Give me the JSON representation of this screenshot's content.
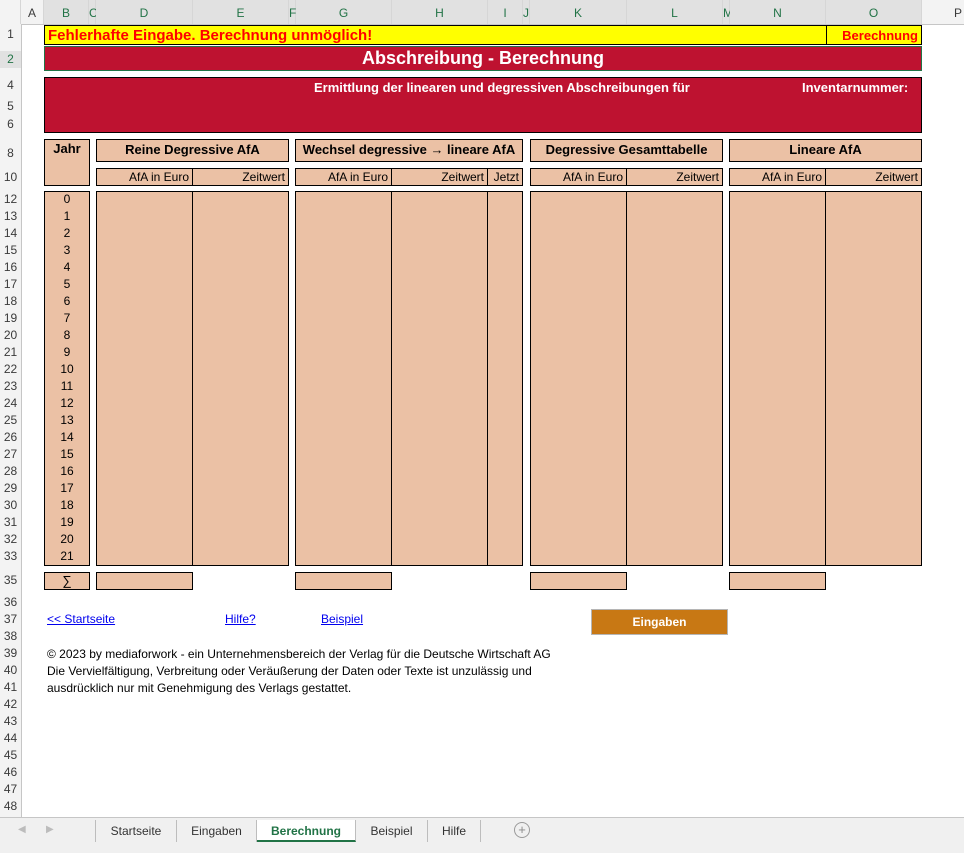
{
  "columns": [
    "A",
    "B",
    "C",
    "D",
    "E",
    "F",
    "G",
    "H",
    "I",
    "J",
    "K",
    "L",
    "M",
    "N",
    "O",
    "P"
  ],
  "rows": [
    "1",
    "2",
    "4",
    "5",
    "6",
    "8",
    "10",
    "12",
    "13",
    "14",
    "15",
    "16",
    "17",
    "18",
    "19",
    "20",
    "21",
    "22",
    "23",
    "24",
    "25",
    "26",
    "27",
    "28",
    "29",
    "30",
    "31",
    "32",
    "33",
    "35",
    "36",
    "37",
    "38",
    "39",
    "40",
    "41",
    "42",
    "43",
    "44",
    "45",
    "46",
    "47",
    "48"
  ],
  "error_banner": "Fehlerhafte Eingabe. Berechnung unmöglich!",
  "error_right": "Berechnung",
  "title": "Abschreibung - Berechnung",
  "subtitle": "Ermittlung der linearen und degressiven Abschreibungen für",
  "inventory_label": "Inventarnummer:",
  "table": {
    "jahr": "Jahr",
    "groups": [
      "Reine Degressive AfA",
      "Wechsel degressive →  lineare AfA",
      "Degressive Gesamttabelle",
      "Lineare AfA"
    ],
    "afa": "AfA in Euro",
    "zeitwert": "Zeitwert",
    "jetzt": "Jetzt",
    "years": [
      "0",
      "1",
      "2",
      "3",
      "4",
      "5",
      "6",
      "7",
      "8",
      "9",
      "10",
      "11",
      "12",
      "13",
      "14",
      "15",
      "16",
      "17",
      "18",
      "19",
      "20",
      "21"
    ],
    "sum_symbol": "∑"
  },
  "links": {
    "startseite": "<< Startseite",
    "hilfe": "Hilfe?",
    "beispiel": "Beispiel"
  },
  "eingaben_button": "Eingaben",
  "copyright": [
    "© 2023 by mediaforwork - ein Unternehmensbereich der Verlag für die Deutsche Wirtschaft AG",
    "Die Vervielfältigung, Verbreitung oder Veräußerung der Daten oder Texte ist unzulässig und",
    "ausdrücklich nur mit Genehmigung des Verlags gestattet."
  ],
  "sheet_tabs": [
    "Startseite",
    "Eingaben",
    "Berechnung",
    "Beispiel",
    "Hilfe"
  ],
  "active_tab": "Berechnung",
  "colors": {
    "banner_yellow": "#ffff00",
    "error_red": "#ff0000",
    "title_red": "#be1230",
    "salmon": "#ebc1a5",
    "button_orange": "#c87814",
    "excel_green": "#217346"
  }
}
